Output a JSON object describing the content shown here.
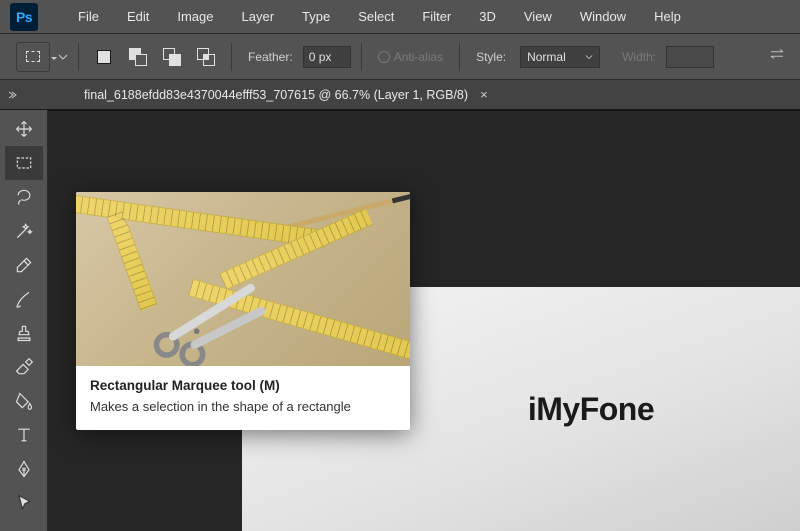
{
  "app": {
    "logo_text": "Ps"
  },
  "menu": [
    "File",
    "Edit",
    "Image",
    "Layer",
    "Type",
    "Select",
    "Filter",
    "3D",
    "View",
    "Window",
    "Help"
  ],
  "options": {
    "feather_label": "Feather:",
    "feather_value": "0 px",
    "antialias_label": "Anti-alias",
    "style_label": "Style:",
    "style_value": "Normal",
    "width_label": "Width:",
    "width_value": ""
  },
  "tab": {
    "title": "final_6188efdd83e4370044efff53_707615 @ 66.7% (Layer 1, RGB/8)",
    "close": "×"
  },
  "canvas": {
    "watermark": "iMyFone"
  },
  "tooltip": {
    "title": "Rectangular Marquee tool (M)",
    "desc": "Makes a selection in the shape of a rectangle"
  },
  "tools": [
    "move-tool",
    "rectangular-marquee-tool",
    "lasso-tool",
    "magic-wand-tool",
    "eyedropper-tool",
    "brush-tool",
    "clone-stamp-tool",
    "eraser-tool",
    "paint-bucket-tool",
    "type-tool",
    "pen-tool",
    "path-selection-tool"
  ]
}
